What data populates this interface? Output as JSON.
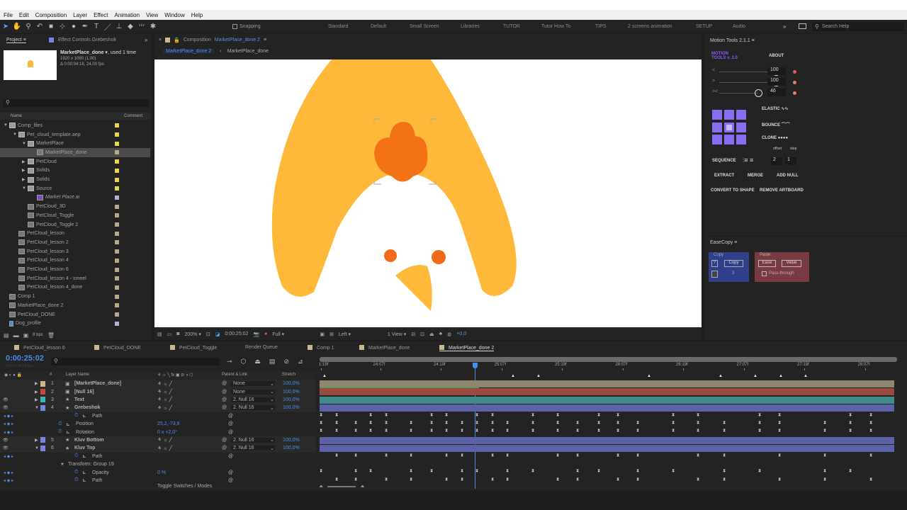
{
  "menu": [
    "File",
    "Edit",
    "Composition",
    "Layer",
    "Effect",
    "Animation",
    "View",
    "Window",
    "Help"
  ],
  "toolbar": {
    "snapping": "Snapping",
    "workspaces": [
      "Standard",
      "Default",
      "Small Screen",
      "Libraries",
      "TUTOR",
      "Tutor How To",
      "TIPS",
      "2 screens animation",
      "SETUP",
      "Audio"
    ],
    "search_placeholder": "Search Help"
  },
  "project": {
    "tab": "Project",
    "effect_tab": "Effect Controls Grebeshok",
    "item_name": "MarketPlace_done",
    "used": ", used 1 time",
    "size": "1920 x 1080 (1,00)",
    "duration": "Δ 0:00:04:18, 24,00 fps",
    "col_name": "Name",
    "col_comment": "Comment",
    "bpc": "8 bpc",
    "items": [
      {
        "name": "Comp_files",
        "depth": 0,
        "type": "folder",
        "open": true,
        "label": "#e8d44d"
      },
      {
        "name": "Pet_cloud_template.aep",
        "depth": 1,
        "type": "folder",
        "open": true,
        "label": "#e8d44d"
      },
      {
        "name": "MarketPlace",
        "depth": 2,
        "type": "folder",
        "open": true,
        "label": "#e8d44d"
      },
      {
        "name": "MarketPlace_done",
        "depth": 3,
        "type": "comp",
        "selected": true,
        "label": "#b9a98a"
      },
      {
        "name": "PetCloud",
        "depth": 2,
        "type": "folder",
        "open": false,
        "label": "#e8d44d"
      },
      {
        "name": "Solids",
        "depth": 2,
        "type": "folder",
        "open": false,
        "label": "#e8d44d"
      },
      {
        "name": "Solids",
        "depth": 2,
        "type": "folder",
        "open": false,
        "label": "#e8d44d"
      },
      {
        "name": "Source",
        "depth": 2,
        "type": "folder",
        "open": true,
        "label": "#e8d44d"
      },
      {
        "name": "Market Place.ai",
        "depth": 3,
        "type": "ai",
        "label": "#b7b0d8"
      },
      {
        "name": "PetCloud_3D",
        "depth": 2,
        "type": "comp",
        "label": "#b9a98a"
      },
      {
        "name": "PetCloud_Toggle",
        "depth": 2,
        "type": "comp",
        "label": "#b9a98a"
      },
      {
        "name": "PetCloud_Toggle 2",
        "depth": 2,
        "type": "comp",
        "label": "#b9a98a"
      },
      {
        "name": "PetCloud_lesson",
        "depth": 1,
        "type": "comp",
        "label": "#b9a98a"
      },
      {
        "name": "PetCloud_lesson 2",
        "depth": 1,
        "type": "comp",
        "label": "#b9a98a"
      },
      {
        "name": "PetCloud_lesson 3",
        "depth": 1,
        "type": "comp",
        "label": "#b9a98a"
      },
      {
        "name": "PetCloud_lesson 4",
        "depth": 1,
        "type": "comp",
        "label": "#b9a98a"
      },
      {
        "name": "PetCloud_lesson 6",
        "depth": 1,
        "type": "comp",
        "label": "#b9a98a"
      },
      {
        "name": "PetCloud_lesson 4 - smeel",
        "depth": 1,
        "type": "comp",
        "label": "#b9a98a"
      },
      {
        "name": "PetCloud_lesson 4_done",
        "depth": 1,
        "type": "comp",
        "label": "#b9a98a"
      },
      {
        "name": "Comp 1",
        "depth": 0,
        "type": "comp",
        "label": "#b9a98a"
      },
      {
        "name": "MarketPlace_done 2",
        "depth": 0,
        "type": "comp",
        "label": "#b9a98a"
      },
      {
        "name": "PetCloud_DONE",
        "depth": 0,
        "type": "comp",
        "label": "#b9a98a"
      },
      {
        "name": "Dog_profile",
        "depth": 0,
        "type": "file",
        "label": "#b7b0d8"
      }
    ]
  },
  "composition": {
    "tab_prefix": "Composition",
    "tab_name": "MarketPlace_done 2",
    "breadcrumb": [
      "MarketPlace_done 2",
      "MarketPlace_done"
    ],
    "footer": {
      "zoom": "200%",
      "time": "0:00:25:02",
      "resolution": "Full",
      "view": "Left",
      "views": "1 View",
      "exposure": "+0,0"
    },
    "colors": {
      "body": "#FFB93A",
      "comb": "#F47216",
      "eye": "#F06A1A",
      "beak": "#FFB93A",
      "bg": "#FFFFFF"
    }
  },
  "motion_tools": {
    "title": "Motion Tools 2.1.1",
    "logo": "MOTION TOOLS v. 2.0",
    "about": "ABOUT",
    "sliders": [
      {
        "icon": "<",
        "value": "100"
      },
      {
        "icon": ">",
        "value": "100"
      },
      {
        "icon": "><",
        "value": "46"
      }
    ],
    "elastic": "ELASTIC",
    "bounce": "BOUNCE",
    "clone": "CLONE",
    "offset": "offset",
    "step": "step",
    "sequence": "SEQUENCE",
    "offset_val": "2",
    "step_val": "1",
    "extract": "EXTRACT",
    "merge": "MERGE",
    "add_null": "ADD NULL",
    "convert": "CONVERT TO SHAPE",
    "remove": "REMOVE ARTBOARD"
  },
  "easecopy": {
    "title": "EaseCopy",
    "copy_group": "Copy",
    "help": "?",
    "copy": "Copy",
    "count": "3",
    "paste_group": "Paste",
    "ease": "Ease",
    "value": "Value",
    "pass": "Pass-through"
  },
  "timeline": {
    "tabs": [
      "PetCloud_lesson 6",
      "PetCloud_DONE",
      "PetCloud_Toggle",
      "Render Queue",
      "Comp 1",
      "MarketPlace_done",
      "MarketPlace_done 2"
    ],
    "timecode": "0:00:25:02",
    "frames": "00602 (24.00 fps)",
    "headers": {
      "num": "#",
      "layer": "Layer Name",
      "parent": "Parent & Link",
      "stretch": "Stretch"
    },
    "ruler": [
      "1:19f",
      "24:07f",
      "24:19f",
      "25:07f",
      "25:19f",
      "26:07f",
      "26:19f",
      "27:07f",
      "27:19f",
      "28:07f"
    ],
    "toggle": "Toggle Switches / Modes",
    "rows": [
      {
        "kind": "layer",
        "num": "1",
        "name": "[MarketPlace_done]",
        "color": "#c9b98f",
        "parent": "None",
        "stretch": "100,0%",
        "bar": "#8f8670",
        "eye": false
      },
      {
        "kind": "layer",
        "num": "2",
        "name": "[Null 16]",
        "color": "#c2493a",
        "parent": "None",
        "stretch": "100,0%",
        "bar": "#9a4a40",
        "eye": false
      },
      {
        "kind": "layer",
        "num": "3",
        "name": "Text",
        "color": "#3fb4b4",
        "parent": "2. Null 16",
        "stretch": "100,0%",
        "bar": "#3f8a8a",
        "eye": true
      },
      {
        "kind": "layer",
        "num": "4",
        "name": "Grebeshok",
        "color": "#7b84e0",
        "parent": "2. Null 16",
        "stretch": "100,0%",
        "bar": "#5b62a8",
        "eye": true,
        "open": true
      },
      {
        "kind": "prop",
        "name": "Path",
        "value": "",
        "indent": 2
      },
      {
        "kind": "prop",
        "name": "Position",
        "value": "25,2,-73,8",
        "indent": 1
      },
      {
        "kind": "prop",
        "name": "Rotation",
        "value": "0 x +2,0°",
        "indent": 1
      },
      {
        "kind": "layer",
        "num": "5",
        "name": "Kluv Bottom",
        "color": "#7b84e0",
        "parent": "2. Null 16",
        "stretch": "100,0%",
        "bar": "#5b62a8",
        "eye": true
      },
      {
        "kind": "layer",
        "num": "6",
        "name": "Kluv Top",
        "color": "#7b84e0",
        "parent": "2. Null 16",
        "stretch": "100,0%",
        "bar": "#5b62a8",
        "eye": true,
        "open": true
      },
      {
        "kind": "prop",
        "name": "Path",
        "value": "",
        "indent": 2
      },
      {
        "kind": "group",
        "name": "Transform: Group 19"
      },
      {
        "kind": "prop",
        "name": "Opacity",
        "value": "0 %",
        "indent": 2
      },
      {
        "kind": "prop",
        "name": "Path",
        "value": "",
        "indent": 2
      }
    ]
  }
}
